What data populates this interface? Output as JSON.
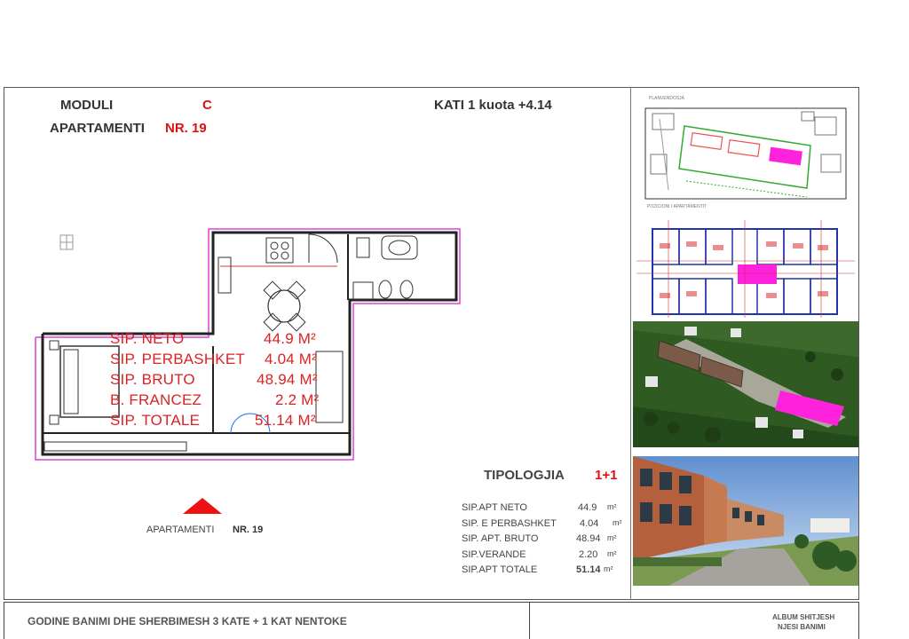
{
  "header": {
    "moduli_label": "MODULI",
    "moduli_value": "C",
    "apartamenti_label": "APARTAMENTI",
    "apartamenti_value": "NR. 19",
    "kati": "KATI 1  kuota +4.14"
  },
  "plan_areas": [
    {
      "label": "SIP. NETO",
      "value": "44.9 M²"
    },
    {
      "label": "SIP. PERBASHKET",
      "value": "4.04 M²"
    },
    {
      "label": "SIP. BRUTO",
      "value": "48.94 M²"
    },
    {
      "label": "B. FRANCEZ",
      "value": "2.2 M²"
    },
    {
      "label": "SIP. TOTALE",
      "value": "51.14 M²"
    }
  ],
  "caption": {
    "label": "APARTAMENTI",
    "value": "NR. 19"
  },
  "tipologjia": {
    "label": "TIPOLOGJIA",
    "value": "1+1"
  },
  "table": [
    {
      "label": "SIP.APT NETO",
      "value": "44.9",
      "unit": "m²"
    },
    {
      "label": "SIP. E PERBASHKET",
      "value": "4.04",
      "unit": "m²"
    },
    {
      "label": "SIP. APT. BRUTO",
      "value": "48.94",
      "unit": "m²"
    },
    {
      "label": "SIP.VERANDE",
      "value": "2.20",
      "unit": "m²"
    },
    {
      "label": "SIP.APT TOTALE",
      "value": "51.14",
      "unit": "m²"
    }
  ],
  "thumbnails": {
    "site_label": "PLANVENDOSJA",
    "position_label": "POZICIONI I APARTAMENTIT"
  },
  "footer": {
    "left": "GODINE BANIMI DHE SHERBIMESH 3 KATE + 1 KAT NENTOKE",
    "right_line1": "ALBUM SHITJESH",
    "right_line2": "NJESI BANIMI"
  },
  "colors": {
    "accent_red": "#d11111",
    "highlight_magenta": "#ff22dd"
  }
}
